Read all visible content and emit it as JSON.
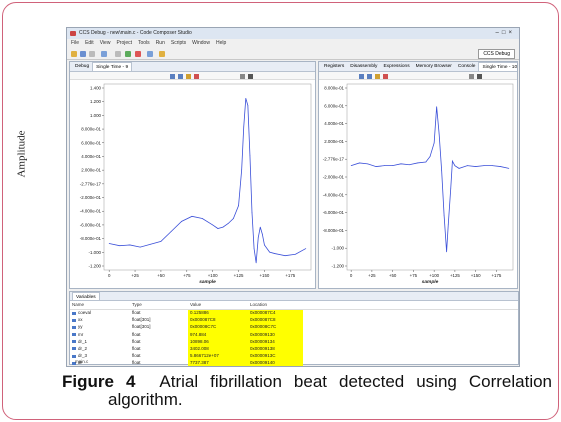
{
  "figure": {
    "ylabel": "Amplitude",
    "caption_label": "Figure 4",
    "caption_line1": "Atrial fibrillation beat detected using Correlation",
    "caption_line2": "algorithm."
  },
  "window": {
    "title": "CCS Debug - new\\main.c - Code Composer Studio",
    "menu": [
      "File",
      "Edit",
      "View",
      "Project",
      "Tools",
      "Run",
      "Scripts",
      "Window",
      "Help"
    ],
    "perspective": "CCS Debug"
  },
  "left_pane": {
    "tabs": [
      "Debug",
      "Single Time - 9"
    ],
    "xlabel": "sample",
    "y_tick_labels": [
      "1.400",
      "1.200",
      "1.000",
      "8.000e-01",
      "6.000e-01",
      "4.000e-01",
      "2.000e-01",
      "-2.776e-17",
      "-2.000e-01",
      "-4.000e-01",
      "-6.000e-01",
      "-8.000e-01",
      "-1.000",
      "-1.200"
    ],
    "x_tick_labels": [
      "0",
      "+25",
      "+50",
      "+75",
      "+100",
      "+125",
      "+150",
      "+175"
    ]
  },
  "right_pane": {
    "tabs": [
      "Registers",
      "Disassembly",
      "Expressions",
      "Memory Browser",
      "Console",
      "Single Time - 10"
    ],
    "xlabel": "sample",
    "y_tick_labels": [
      "8.000e-01",
      "6.000e-01",
      "4.000e-01",
      "2.000e-01",
      "-2.776e-17",
      "-2.000e-01",
      "-4.000e-01",
      "-6.000e-01",
      "-8.000e-01",
      "-1.000",
      "-1.200"
    ],
    "x_tick_labels": [
      "0",
      "+25",
      "+50",
      "+75",
      "+100",
      "+125",
      "+150",
      "+175"
    ]
  },
  "variables": {
    "tab": "Variables",
    "columns": [
      "Name",
      "Type",
      "Value",
      "Location"
    ],
    "rows": [
      {
        "name": "coeval",
        "type": "float",
        "value": "0.125886",
        "location": "0x000087C4"
      },
      {
        "name": "xx",
        "type": "float[301]",
        "value": "0x000087C8",
        "location": "0x000087C8"
      },
      {
        "name": "yy",
        "type": "float[301]",
        "value": "0x00008C7C",
        "location": "0x00008C7C"
      },
      {
        "name": "mr",
        "type": "float",
        "value": "974.884",
        "location": "0x00009130"
      },
      {
        "name": "dr_1",
        "type": "float",
        "value": "10898.06",
        "location": "0x00009134"
      },
      {
        "name": "dr_2",
        "type": "float",
        "value": "3402.008",
        "location": "0x00009138"
      },
      {
        "name": "dr_3",
        "type": "float",
        "value": "5.866712e+07",
        "location": "0x0000913C"
      },
      {
        "name": "dr",
        "type": "float",
        "value": "7737.387",
        "location": "0x00009140"
      }
    ]
  },
  "status": {
    "file": "main.c"
  },
  "chart_data": [
    {
      "type": "line",
      "xlabel": "sample",
      "ylabel": "",
      "xlim": [
        -5,
        195
      ],
      "ylim": [
        -1.2,
        1.4
      ],
      "x": [
        0,
        10,
        20,
        30,
        40,
        50,
        60,
        70,
        80,
        90,
        100,
        105,
        110,
        115,
        120,
        125,
        128,
        130,
        132,
        134,
        136,
        138,
        140,
        142,
        144,
        146,
        148,
        150,
        155,
        160,
        170,
        180,
        190
      ],
      "values": [
        -0.83,
        -0.86,
        -0.85,
        -0.88,
        -0.84,
        -0.8,
        -0.66,
        -0.52,
        -0.45,
        -0.48,
        -0.57,
        -0.62,
        -0.6,
        -0.55,
        -0.48,
        -0.3,
        0.2,
        0.8,
        1.2,
        1.1,
        0.4,
        -0.4,
        -0.9,
        -1.1,
        -0.75,
        -0.6,
        -0.7,
        -0.85,
        -0.95,
        -0.97,
        -1.0,
        -0.98,
        -0.9
      ]
    },
    {
      "type": "line",
      "xlabel": "sample",
      "ylabel": "",
      "xlim": [
        -5,
        195
      ],
      "ylim": [
        -1.2,
        0.85
      ],
      "x": [
        0,
        10,
        20,
        30,
        40,
        50,
        60,
        70,
        80,
        90,
        95,
        100,
        103,
        106,
        109,
        112,
        115,
        117,
        120,
        122,
        125,
        130,
        140,
        150,
        160,
        170,
        180,
        190
      ],
      "values": [
        -0.05,
        -0.02,
        -0.03,
        -0.06,
        -0.05,
        -0.05,
        -0.03,
        -0.04,
        -0.02,
        -0.01,
        0.05,
        0.2,
        0.6,
        0.3,
        -0.1,
        -0.6,
        -1.0,
        -0.7,
        -0.3,
        0.0,
        -0.05,
        -0.08,
        -0.05,
        -0.06,
        -0.05,
        -0.05,
        -0.06,
        -0.08
      ]
    }
  ]
}
